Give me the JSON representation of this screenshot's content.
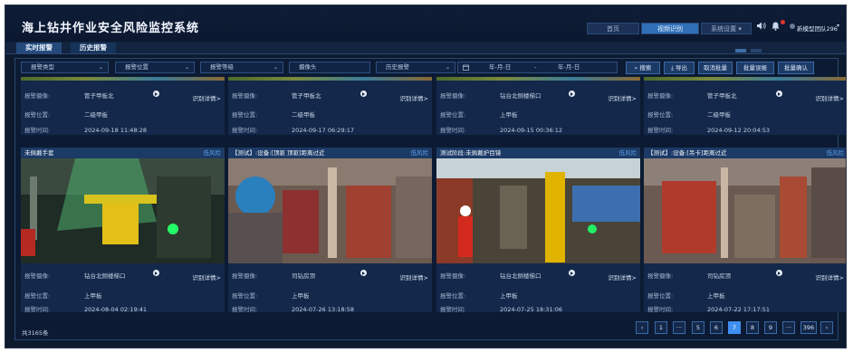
{
  "app": {
    "title": "海上钻井作业安全风险监控系统",
    "nav": [
      "首页",
      "视频识别",
      "系统设置"
    ],
    "system_dropdown_marker": "▾",
    "user": "新模型团队296",
    "icons": {
      "volume": "speaker-icon",
      "bell": "bell-icon",
      "user_chevron": "chevron-down-icon"
    }
  },
  "tabs": [
    "实时报警",
    "历史报警"
  ],
  "filters": {
    "alarm_type": "报警类型",
    "alarm_location": "报警位置",
    "alarm_level": "报警等级",
    "camera": "摄像头",
    "alarm_status": "历史报警",
    "date_start": "年-月-日",
    "date_sep": "-",
    "date_end": "年-月-日"
  },
  "buttons": [
    "搜索",
    "导出",
    "取消批量",
    "批量误报",
    "批量确认"
  ],
  "labels": {
    "camera": "报警摄像:",
    "location": "报警位置:",
    "time": "报警时间:",
    "detail": "识别详情>"
  },
  "top_cards": [
    {
      "camera": "管子甲板北",
      "location": "二级甲板",
      "time": "2024-09-18 11:48:28"
    },
    {
      "camera": "管子甲板北",
      "location": "二级甲板",
      "time": "2024-09-17 06:29:17"
    },
    {
      "camera": "钻台北侧楼梯口",
      "location": "上甲板",
      "time": "2024-09-15 00:36:12"
    },
    {
      "camera": "管子甲板北",
      "location": "二级甲板",
      "time": "2024-09-12 20:04:53"
    }
  ],
  "bottom_cards": [
    {
      "title": "未佩戴手套",
      "risk": "低风险",
      "camera": "钻台北侧楼梯口",
      "location": "上甲板",
      "time": "2024-08-04 02:19:41"
    },
    {
      "title": "【测试】:设备:[顶驱 顶驱]距离过近",
      "risk": "低风险",
      "camera": "司钻房顶",
      "location": "上甲板",
      "time": "2024-07-26 13:18:58"
    },
    {
      "title": "测试阶段:未佩戴护目镜",
      "risk": "低风险",
      "camera": "钻台北侧楼梯口",
      "location": "上甲板",
      "time": "2024-07-25 18:31:06"
    },
    {
      "title": "【测试】:设备:[吊卡]距离过近",
      "risk": "低风险",
      "camera": "司钻房顶",
      "location": "上甲板",
      "time": "2024-07-22 17:17:51"
    }
  ],
  "pagination": {
    "total": "共3165条",
    "pages": [
      "‹",
      "1",
      "···",
      "5",
      "6",
      "7",
      "8",
      "9",
      "···",
      "396",
      "›"
    ],
    "current": "7"
  },
  "colors": {
    "accent": "#3f8ff0",
    "risk_text": "#5c9ee8",
    "background": "#0d1a2e"
  }
}
